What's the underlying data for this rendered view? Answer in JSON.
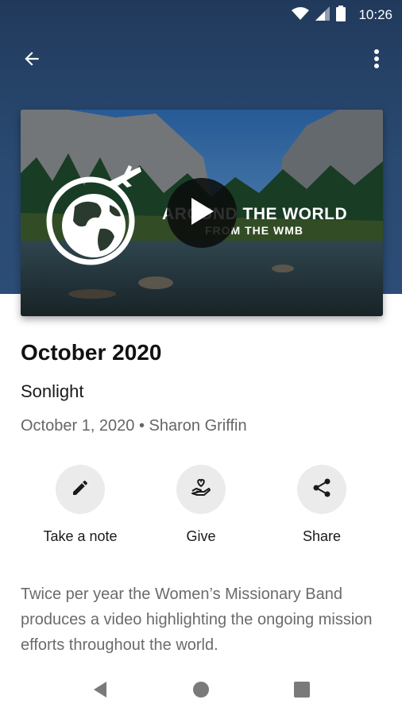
{
  "status": {
    "time": "10:26",
    "icons": [
      "wifi-icon",
      "signal-icon",
      "battery-icon"
    ]
  },
  "app_bar": {
    "back_icon": "arrow-back-icon",
    "menu_icon": "more-vert-icon"
  },
  "video": {
    "title": "AROUND THE WORLD",
    "subtitle": "FROM THE WMB",
    "play_icon": "play-icon",
    "logo_icon": "globe-plane-icon"
  },
  "content": {
    "title": "October 2020",
    "subtitle": "Sonlight",
    "meta": "October 1, 2020 • Sharon Griffin"
  },
  "actions": [
    {
      "label": "Take a note",
      "icon": "pencil-icon"
    },
    {
      "label": "Give",
      "icon": "give-heart-hand-icon"
    },
    {
      "label": "Share",
      "icon": "share-icon"
    }
  ],
  "description": "Twice per year the Women’s Missionary Band produces a video highlighting the ongoing mission efforts throughout the world.",
  "colors": {
    "header": "#2a4a72",
    "action_bg": "#ebebeb",
    "text_secondary": "#666666"
  },
  "nav": {
    "icons": [
      "nav-back-icon",
      "nav-home-icon",
      "nav-recents-icon"
    ]
  }
}
